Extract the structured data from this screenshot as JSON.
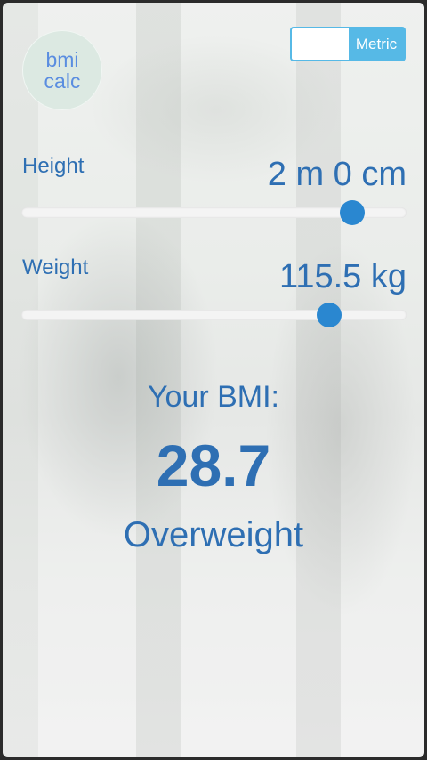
{
  "logo": {
    "line1": "bmi",
    "line2": "calc"
  },
  "unit_toggle": {
    "label": "Metric",
    "state": "on"
  },
  "height": {
    "label": "Height",
    "value": "2 m 0 cm",
    "slider_fraction": 0.86
  },
  "weight": {
    "label": "Weight",
    "value": "115.5 kg",
    "slider_fraction": 0.8
  },
  "result": {
    "heading": "Your BMI:",
    "value": "28.7",
    "category": "Overweight"
  },
  "colors": {
    "accent": "#2e6fb3",
    "toggle": "#56b9e6",
    "thumb": "#2a87d0"
  }
}
